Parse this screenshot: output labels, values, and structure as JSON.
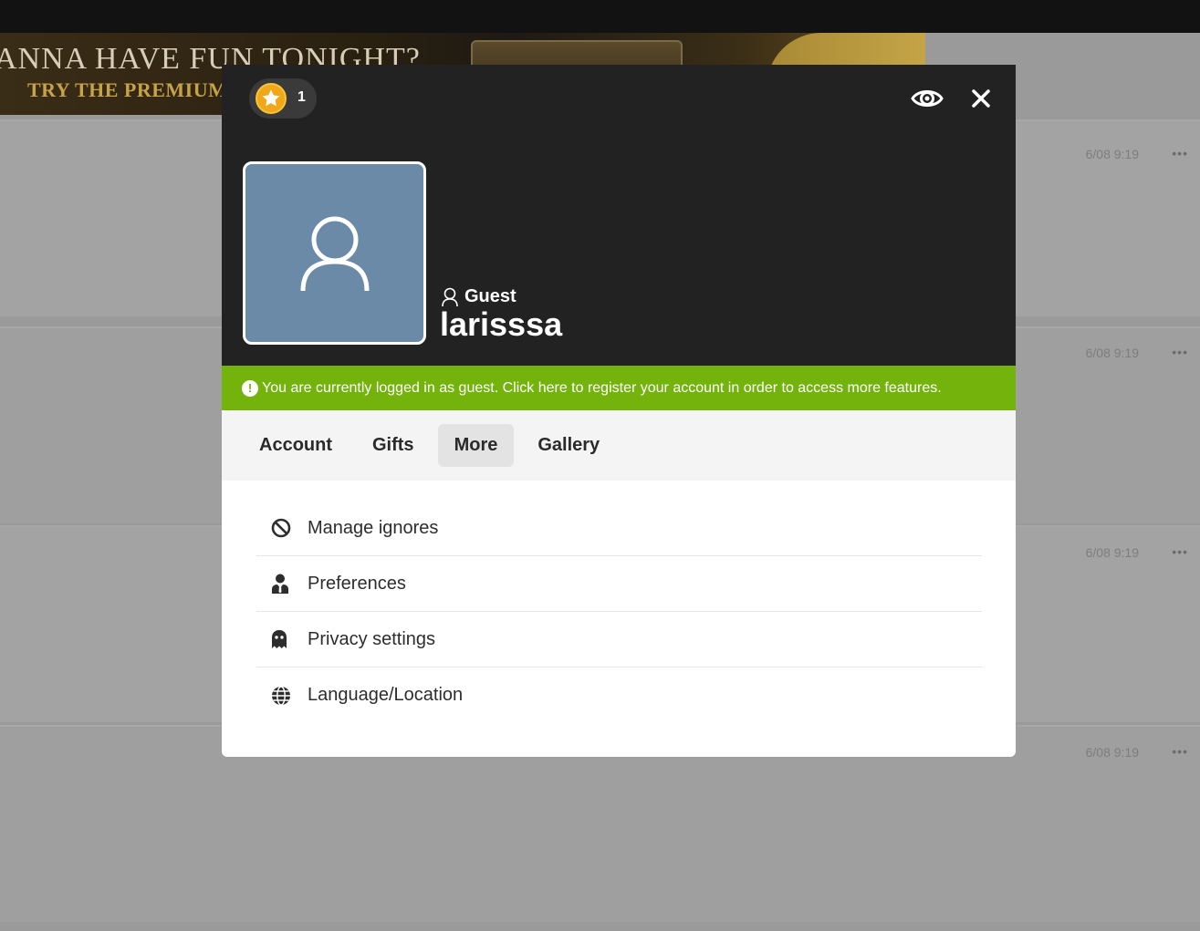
{
  "background": {
    "banner": {
      "headline": "ANNA HAVE FUN TONIGHT?",
      "subline": "TRY THE PREMIUM"
    },
    "feed_rows": [
      {
        "time": "6/08 9:19",
        "menu": "•••"
      },
      {
        "time": "6/08 9:19",
        "menu": "•••"
      },
      {
        "time": "6/08 9:19",
        "menu": "•••"
      },
      {
        "time": "6/08 9:19",
        "menu": "•••"
      }
    ]
  },
  "profile": {
    "coin_count": "1",
    "rank": "Guest",
    "username": "larisssa",
    "avatar_icon": "user-outline-icon"
  },
  "notice": {
    "icon": "!",
    "text": "You are currently logged in as guest. Click here to register your account in order to access more features."
  },
  "tabs": [
    {
      "label": "Account",
      "active": false
    },
    {
      "label": "Gifts",
      "active": false
    },
    {
      "label": "More",
      "active": true
    },
    {
      "label": "Gallery",
      "active": false
    }
  ],
  "menu": [
    {
      "label": "Manage ignores",
      "icon": "ban-icon"
    },
    {
      "label": "Preferences",
      "icon": "user-tie-icon"
    },
    {
      "label": "Privacy settings",
      "icon": "ghost-icon"
    },
    {
      "label": "Language/Location",
      "icon": "globe-icon"
    }
  ],
  "colors": {
    "header_bg": "#222222",
    "notice_green": "#73b30c",
    "avatar_bg": "#6a8aa7",
    "coin_gold": "#f0a818"
  }
}
